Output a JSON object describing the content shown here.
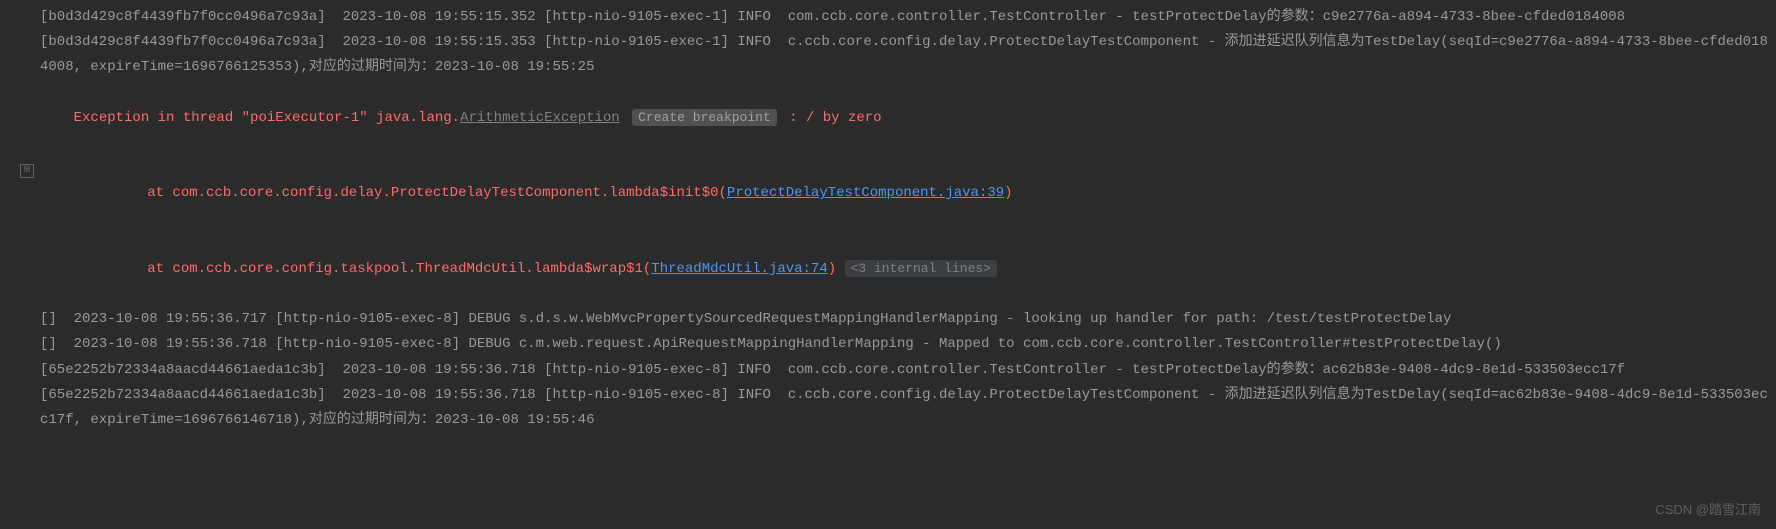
{
  "lines": {
    "l1": "[b0d3d429c8f4439fb7f0cc0496a7c93a]  2023-10-08 19:55:15.352 [http-nio-9105-exec-1] INFO  com.ccb.core.controller.TestController - testProtectDelay的参数：c9e2776a-a894-4733-8bee-cfded0184008",
    "l2": "[b0d3d429c8f4439fb7f0cc0496a7c93a]  2023-10-08 19:55:15.353 [http-nio-9105-exec-1] INFO  c.ccb.core.config.delay.ProtectDelayTestComponent - 添加进延迟队列信息为TestDelay(seqId=c9e2776a-a894-4733-8bee-cfded0184008, expireTime=1696766125353),对应的过期时间为：2023-10-08 19:55:25",
    "ex_prefix": "Exception in thread \"poiExecutor-1\" java.lang.",
    "ex_class": "ArithmeticException",
    "ex_breakpoint": "Create breakpoint",
    "ex_suffix": " : / by zero",
    "st1_prefix": "    at com.ccb.core.config.delay.ProtectDelayTestComponent.lambda$init$0(",
    "st1_link": "ProtectDelayTestComponent.java:39",
    "st1_suffix": ")",
    "st2_prefix": "    at com.ccb.core.config.taskpool.ThreadMdcUtil.lambda$wrap$1(",
    "st2_link": "ThreadMdcUtil.java:74",
    "st2_suffix": ")",
    "st2_folded": "<3 internal lines>",
    "l3": "[]  2023-10-08 19:55:36.717 [http-nio-9105-exec-8] DEBUG s.d.s.w.WebMvcPropertySourcedRequestMappingHandlerMapping - looking up handler for path: /test/testProtectDelay",
    "l4": "[]  2023-10-08 19:55:36.718 [http-nio-9105-exec-8] DEBUG c.m.web.request.ApiRequestMappingHandlerMapping - Mapped to com.ccb.core.controller.TestController#testProtectDelay()",
    "l5": "[65e2252b72334a8aacd44661aeda1c3b]  2023-10-08 19:55:36.718 [http-nio-9105-exec-8] INFO  com.ccb.core.controller.TestController - testProtectDelay的参数：ac62b83e-9408-4dc9-8e1d-533503ecc17f",
    "l6": "[65e2252b72334a8aacd44661aeda1c3b]  2023-10-08 19:55:36.718 [http-nio-9105-exec-8] INFO  c.ccb.core.config.delay.ProtectDelayTestComponent - 添加进延迟队列信息为TestDelay(seqId=ac62b83e-9408-4dc9-8e1d-533503ecc17f, expireTime=1696766146718),对应的过期时间为：2023-10-08 19:55:46"
  },
  "fold_icon": "⊞",
  "watermark": "CSDN @踏雪江南"
}
